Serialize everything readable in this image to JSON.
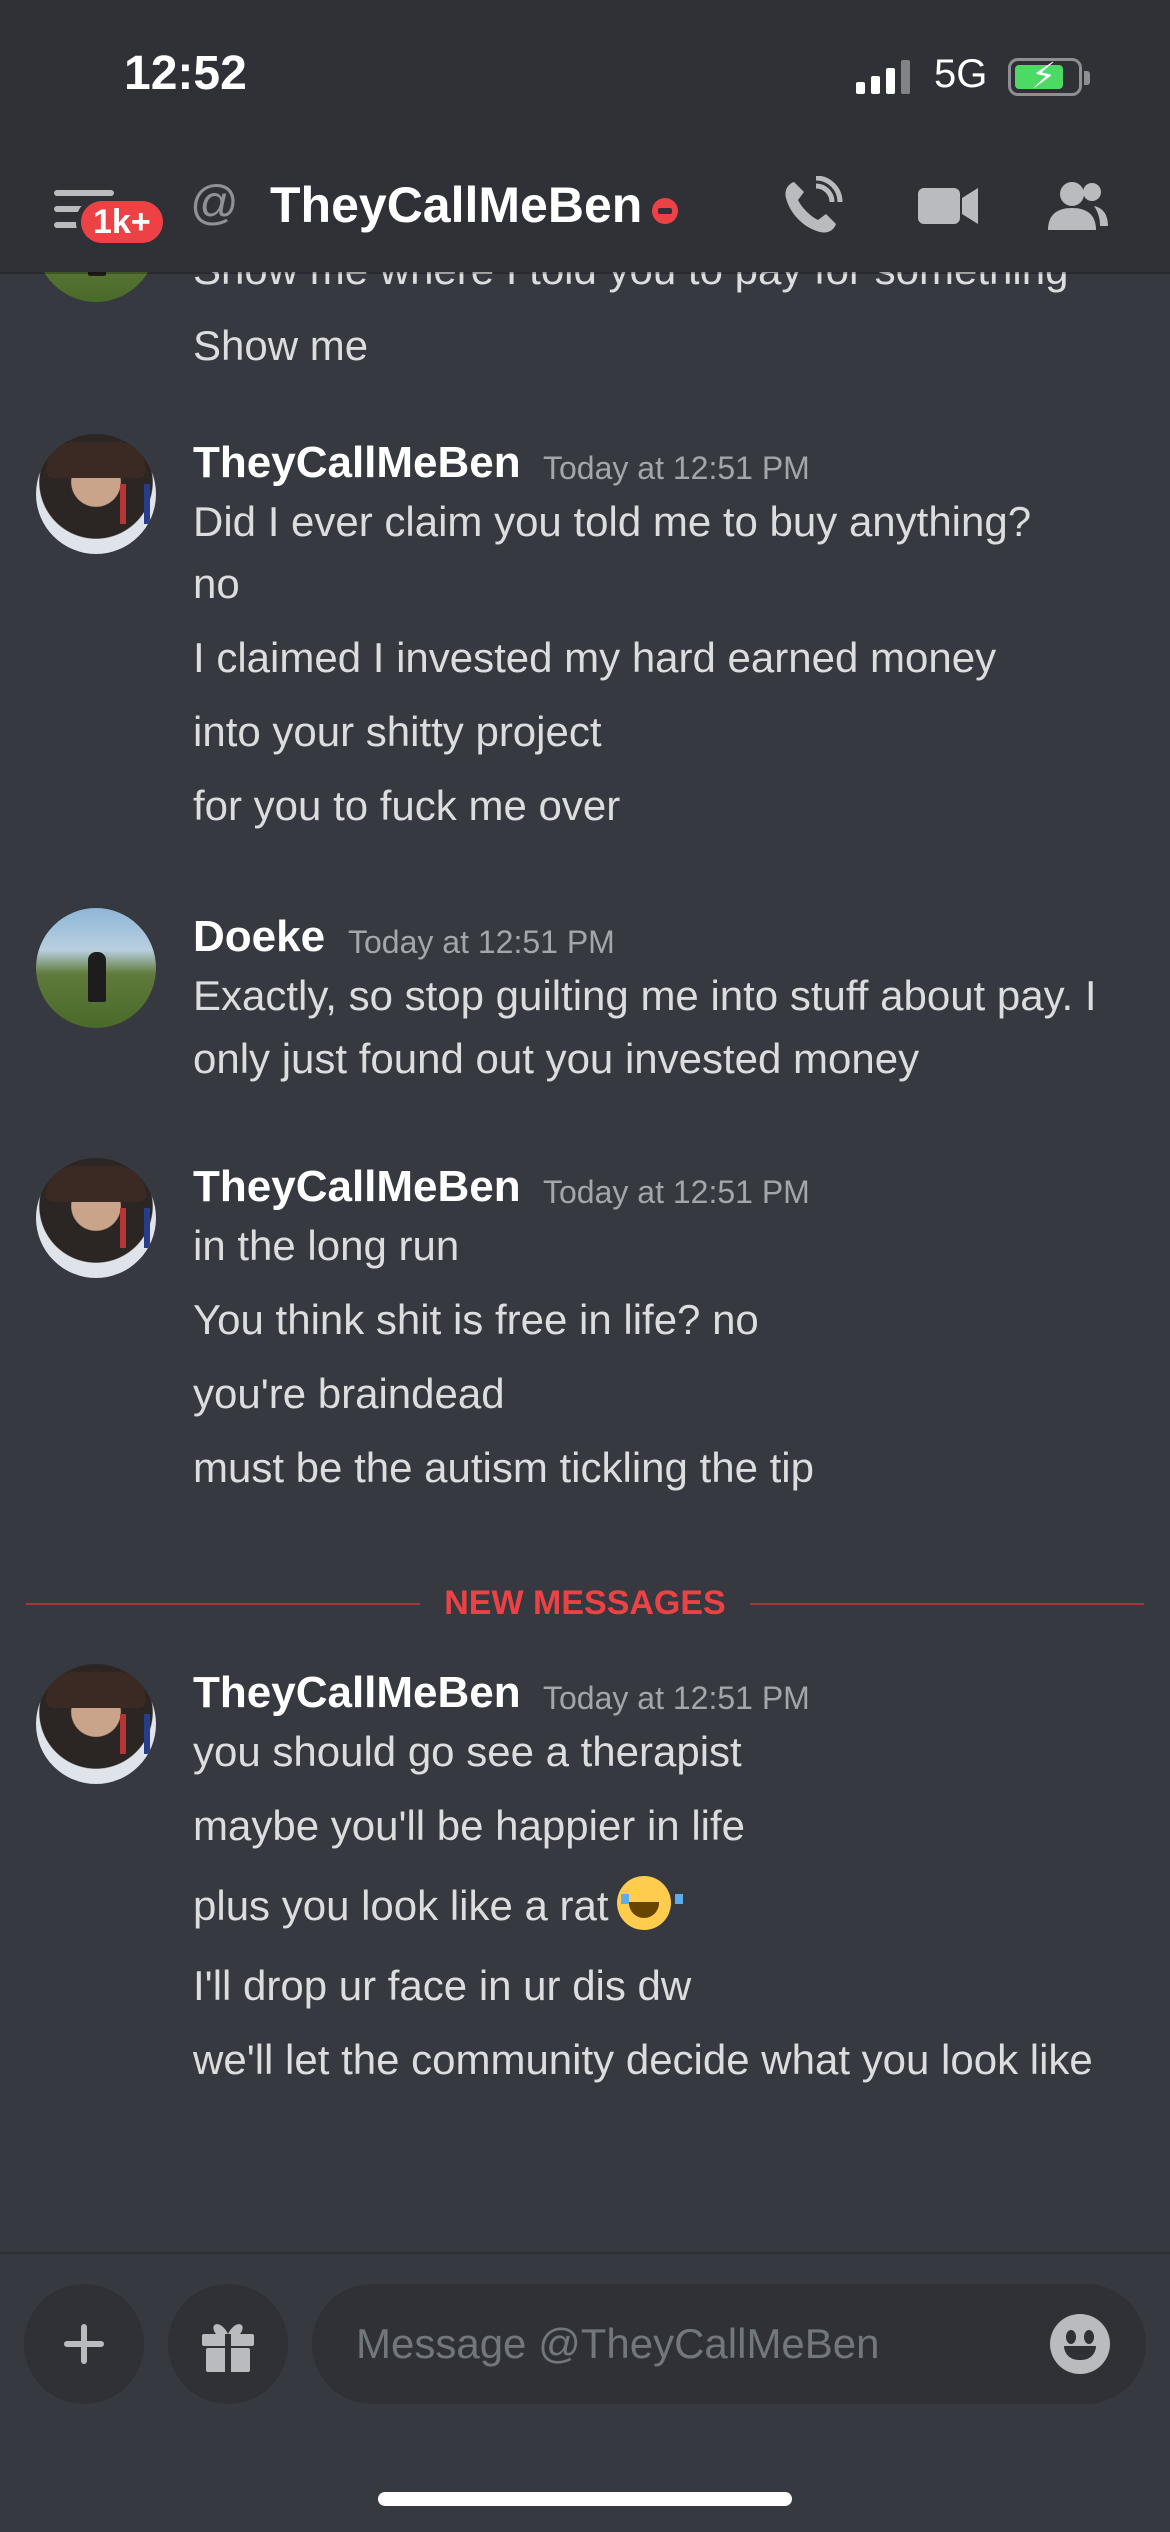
{
  "status_bar": {
    "time": "12:52",
    "network": "5G"
  },
  "header": {
    "notification_badge": "1k+",
    "at_symbol": "@",
    "channel_name": "TheyCallMeBen"
  },
  "messages": {
    "partial_top": {
      "cut_line": "Show me where I told you to pay for something",
      "line": "Show me"
    },
    "group1": {
      "author": "TheyCallMeBen",
      "time": "Today at 12:51 PM",
      "lines": [
        "Did I ever claim you told me to buy anything?",
        "no",
        "I claimed I invested my hard earned money",
        "into your shitty project",
        "for you to fuck me over"
      ]
    },
    "group2": {
      "author": "Doeke",
      "time": "Today at 12:51 PM",
      "lines": [
        "Exactly, so stop guilting me into stuff about pay. I only just found out you invested money"
      ]
    },
    "group3": {
      "author": "TheyCallMeBen",
      "time": "Today at 12:51 PM",
      "lines": [
        "in the long run",
        "You think shit is free in life? no",
        "you're braindead",
        "must be the autism tickling the tip"
      ]
    },
    "divider_label": "NEW MESSAGES",
    "group4": {
      "author": "TheyCallMeBen",
      "time": "Today at 12:51 PM",
      "lines": [
        "you should go see a therapist",
        "maybe you'll be happier in life",
        "plus you look like a rat",
        "I'll drop ur face in ur dis dw",
        "we'll let the community decide what you look like"
      ]
    }
  },
  "composer": {
    "placeholder": "Message @TheyCallMeBen"
  },
  "colors": {
    "background": "#36393f",
    "header": "#2f3136",
    "danger": "#ed4245",
    "text": "#dcddde"
  }
}
